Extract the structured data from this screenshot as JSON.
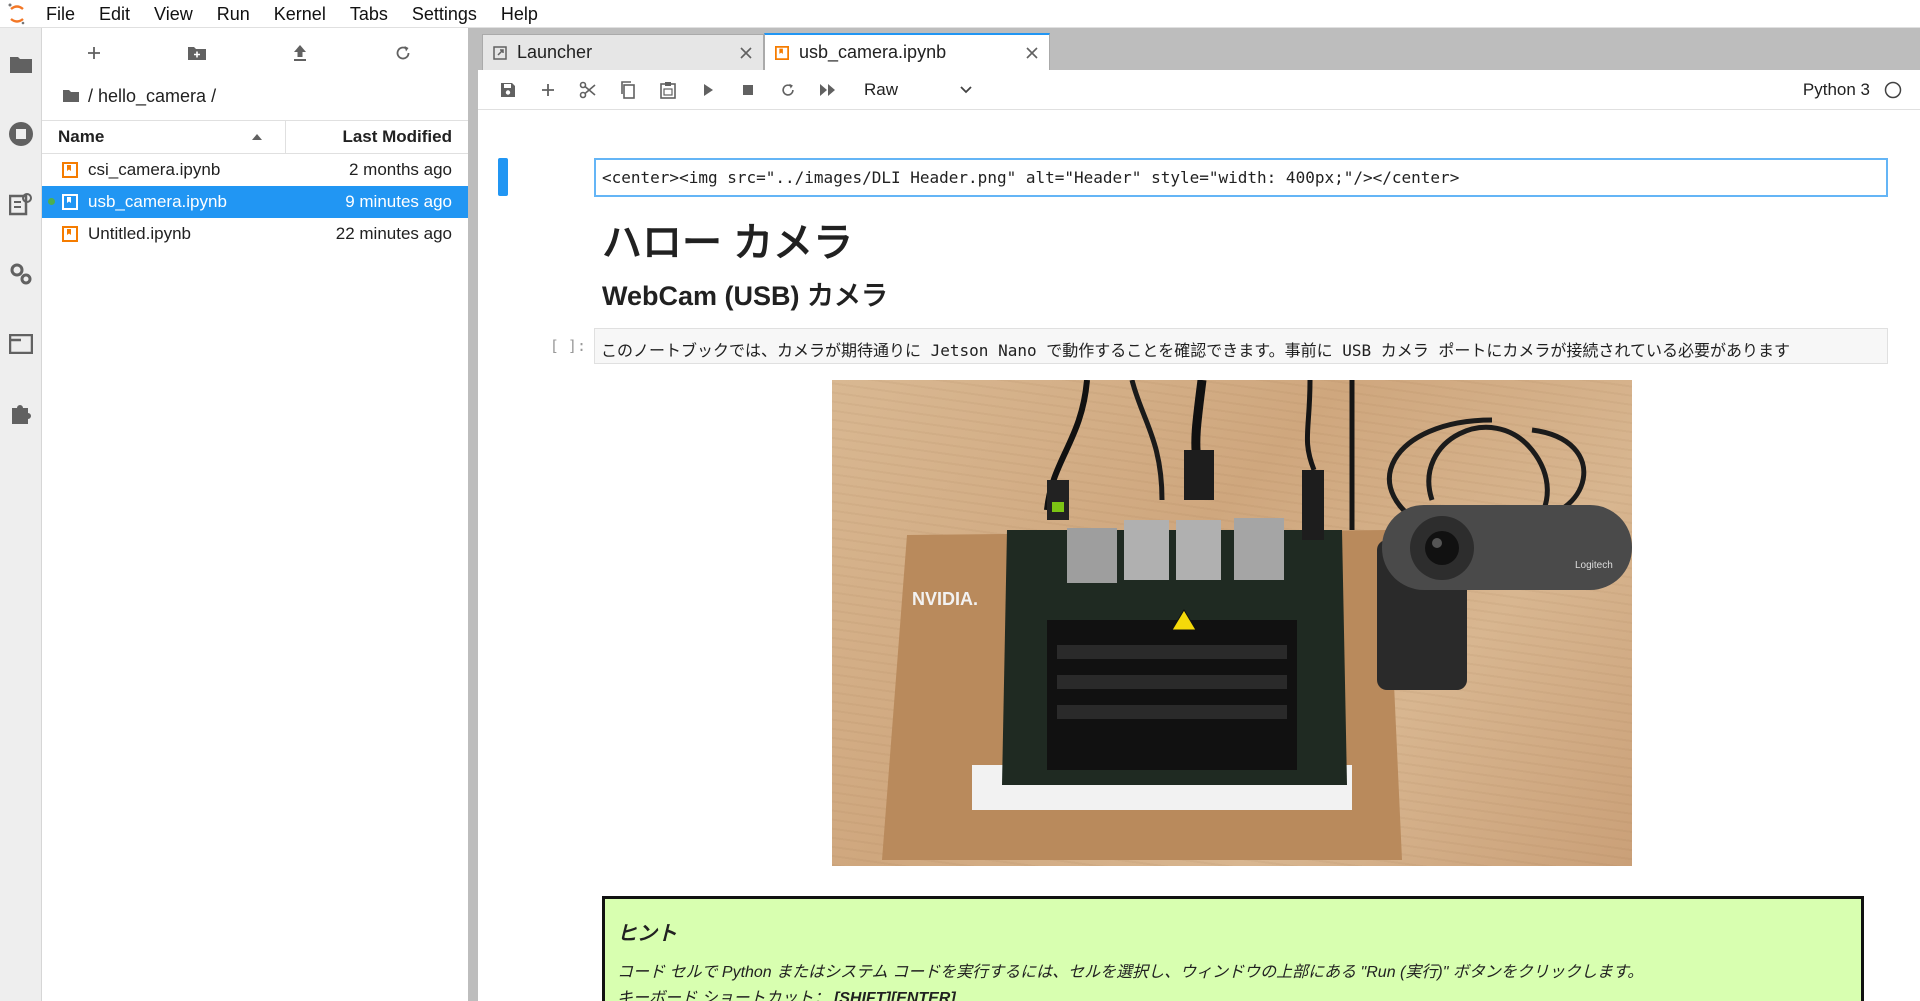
{
  "menubar": {
    "items": [
      "File",
      "Edit",
      "View",
      "Run",
      "Kernel",
      "Tabs",
      "Settings",
      "Help"
    ]
  },
  "sidebar": {
    "icons": [
      "folder-icon",
      "running-icon",
      "commands-icon",
      "property-inspector-icon",
      "tabs-icon",
      "extension-icon"
    ]
  },
  "filebrowser": {
    "breadcrumb": "/ hello_camera /",
    "columns": {
      "name": "Name",
      "modified": "Last Modified"
    },
    "files": [
      {
        "name": "csi_camera.ipynb",
        "modified": "2 months ago",
        "selected": false
      },
      {
        "name": "usb_camera.ipynb",
        "modified": "9 minutes ago",
        "selected": true
      },
      {
        "name": "Untitled.ipynb",
        "modified": "22 minutes ago",
        "selected": false
      }
    ]
  },
  "tabs": [
    {
      "label": "Launcher",
      "active": false
    },
    {
      "label": "usb_camera.ipynb",
      "active": true
    }
  ],
  "toolbar": {
    "cell_type": "Raw",
    "kernel_name": "Python 3"
  },
  "notebook": {
    "raw_cell": "<center><img src=\"../images/DLI Header.png\" alt=\"Header\" style=\"width: 400px;\"/></center>",
    "heading1": "ハロー カメラ",
    "heading2": "WebCam (USB) カメラ",
    "code_prompt": "[ ]:",
    "code_cell": "このノートブックでは、カメラが期待通りに Jetson Nano で動作することを確認できます。事前に USB カメラ ポートにカメラが接続されている必要があります",
    "photo_brand_nvidia": "NVIDIA.",
    "photo_brand_logitech": "Logitech",
    "hint": {
      "title": "ヒント",
      "line1": "コード セルで Python またはシステム コードを実行するには、セルを選択し、ウィンドウの上部にある \"Run (実行)\" ボタンをクリックします。",
      "line2_label": "キーボード ショートカット：",
      "line2_keys": "[SHIFT][ENTER]"
    }
  },
  "colors": {
    "accent": "#2196f3",
    "hint_bg": "#d8ffb0",
    "notebook_icon": "#f57c00"
  }
}
